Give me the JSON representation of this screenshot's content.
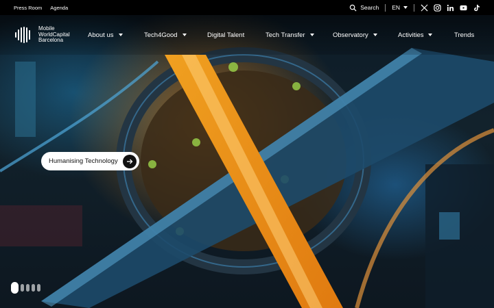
{
  "topbar": {
    "links": [
      "Press Room",
      "Agenda"
    ],
    "search_label": "Search",
    "language": "EN",
    "social_icons": [
      "x-icon",
      "instagram-icon",
      "linkedin-icon",
      "youtube-icon",
      "tiktok-icon"
    ]
  },
  "logo": {
    "line1": "Mobile",
    "line2": "WorldCapital",
    "line3": "Barcelona"
  },
  "nav": {
    "items": [
      {
        "label": "About us",
        "has_dropdown": true
      },
      {
        "label": "Tech4Good",
        "has_dropdown": true
      },
      {
        "label": "Digital Talent",
        "has_dropdown": false
      },
      {
        "label": "Tech Transfer",
        "has_dropdown": true
      },
      {
        "label": "Observatory",
        "has_dropdown": true
      },
      {
        "label": "Activities",
        "has_dropdown": true
      },
      {
        "label": "Trends",
        "has_dropdown": false
      }
    ]
  },
  "hero": {
    "cta_label": "Humanising Technology",
    "slides_total": 5,
    "active_slide": 1
  },
  "colors": {
    "topbar_bg": "#000000",
    "cta_bg": "#ffffff",
    "cta_arrow_bg": "#111111"
  }
}
